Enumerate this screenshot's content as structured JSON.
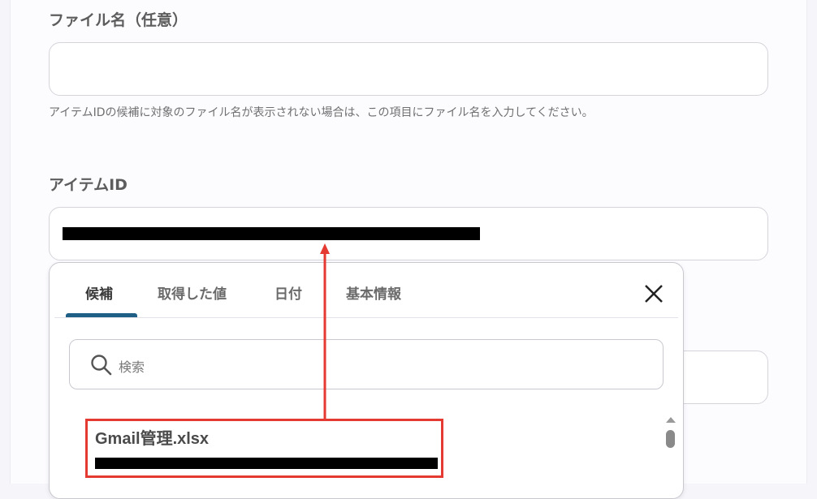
{
  "form": {
    "file_name": {
      "label": "ファイル名（任意）",
      "value": "",
      "hint": "アイテムIDの候補に対象のファイル名が表示されない場合は、この項目にファイル名を入力してください。"
    },
    "item_id": {
      "label": "アイテムID",
      "value_redacted": true
    }
  },
  "dropdown": {
    "tabs": [
      {
        "label": "候補",
        "active": true
      },
      {
        "label": "取得した値",
        "active": false
      },
      {
        "label": "日付",
        "active": false
      },
      {
        "label": "基本情報",
        "active": false
      }
    ],
    "close_icon": "close-icon",
    "search": {
      "placeholder": "検索",
      "icon": "search-icon"
    },
    "results": [
      {
        "title": "Gmail管理.xlsx",
        "subtitle_redacted": true
      }
    ]
  },
  "annotation": {
    "color": "#e53a31"
  }
}
